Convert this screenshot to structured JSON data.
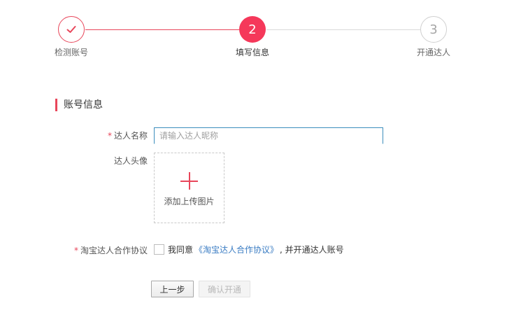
{
  "stepper": {
    "steps": [
      {
        "label": "检测账号",
        "state": "done",
        "icon": "check-icon"
      },
      {
        "label": "填写信息",
        "state": "active",
        "number": "2"
      },
      {
        "label": "开通达人",
        "state": "todo",
        "number": "3"
      }
    ]
  },
  "section": {
    "title": "账号信息"
  },
  "form": {
    "name": {
      "required_mark": "*",
      "label": "达人名称",
      "value": "",
      "placeholder": "请输入达人昵称"
    },
    "avatar": {
      "label": "达人头像",
      "upload_icon": "plus-icon",
      "upload_text": "添加上传图片"
    },
    "agreement": {
      "required_mark": "*",
      "label": "淘宝达人合作协议",
      "checked": false,
      "prefix": "我同意",
      "link_text": "《淘宝达人合作协议》",
      "suffix": ", 并开通达人账号"
    }
  },
  "buttons": {
    "prev_label": "上一步",
    "confirm_label": "确认开通"
  },
  "colors": {
    "accent": "#f5385a",
    "line_done": "#e8465a",
    "line_todo": "#d9d9d9",
    "link": "#3a7cc3",
    "input_focus": "#3c8dbc"
  }
}
